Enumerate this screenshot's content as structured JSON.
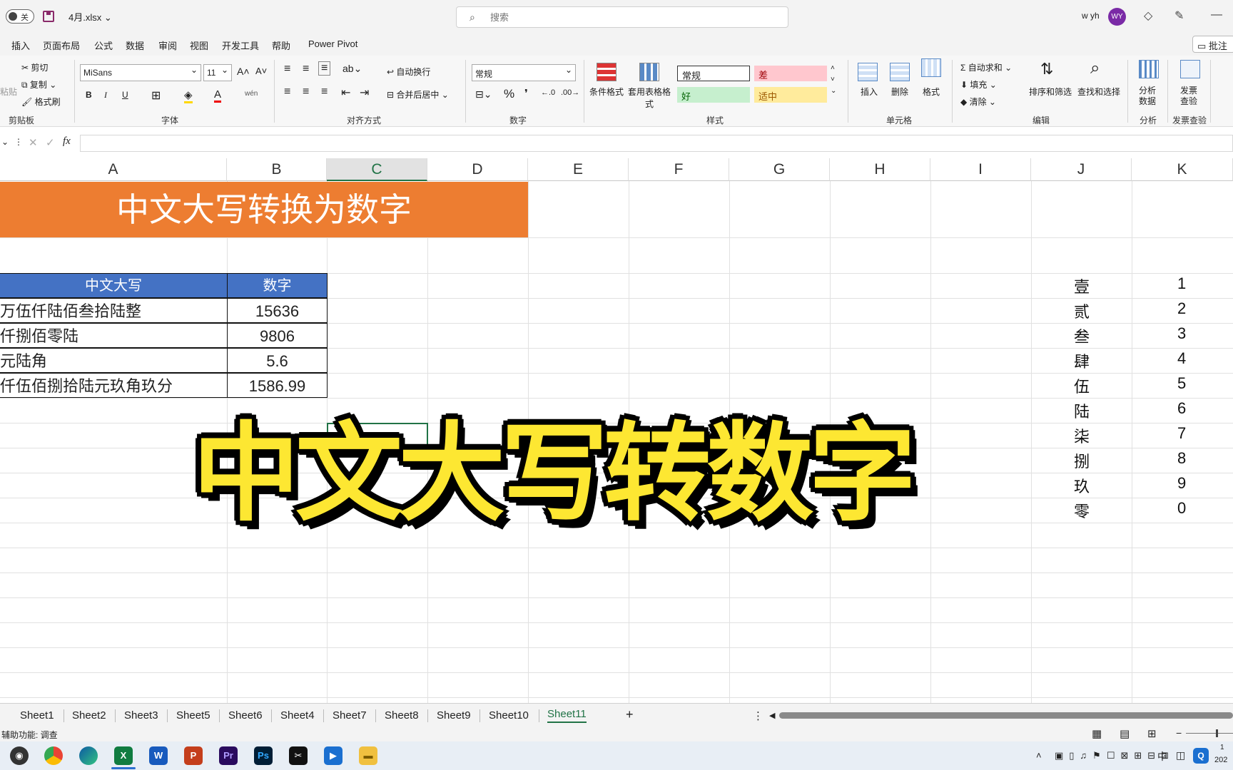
{
  "titlebar": {
    "autosave_label": "关",
    "filename": "4月.xlsx",
    "search_placeholder": "搜索",
    "username": "w yh",
    "avatar_initials": "WY"
  },
  "menu_tabs": [
    "插入",
    "页面布局",
    "公式",
    "数据",
    "审阅",
    "视图",
    "开发工具",
    "帮助",
    "Power Pivot"
  ],
  "comment_button": "批注",
  "ribbon": {
    "clipboard": {
      "paste": "粘贴",
      "cut": "剪切",
      "copy": "复制",
      "format_painter": "格式刷",
      "label": "剪贴板"
    },
    "font": {
      "name": "MiSans",
      "size": "11",
      "bold": "B",
      "italic": "I",
      "underline": "U",
      "label": "字体"
    },
    "alignment": {
      "wrap": "自动换行",
      "merge": "合并后居中",
      "label": "对齐方式"
    },
    "number": {
      "format": "常规",
      "percent": "%",
      "label": "数字"
    },
    "styles": {
      "cond_format": "条件格式",
      "table_format": "套用表格格式",
      "normal": "常规",
      "bad": "差",
      "good": "好",
      "neutral": "适中",
      "label": "样式"
    },
    "cells": {
      "insert": "插入",
      "delete": "删除",
      "format": "格式",
      "label": "单元格"
    },
    "editing": {
      "autosum": "自动求和",
      "fill": "填充",
      "clear": "清除",
      "sort_filter": "排序和筛选",
      "find_select": "查找和选择",
      "label": "编辑"
    },
    "analysis": {
      "analyze": "分析数据",
      "label": "分析"
    },
    "invoice": {
      "check": "发票查验",
      "label": "发票查验"
    }
  },
  "formula_bar": {
    "fx": "fx",
    "value": ""
  },
  "columns": [
    "A",
    "B",
    "C",
    "D",
    "E",
    "F",
    "G",
    "H",
    "I",
    "J",
    "K"
  ],
  "banner_title": "中文大写转换为数字",
  "table": {
    "headers": [
      "中文大写",
      "数字"
    ],
    "rows": [
      [
        "万伍仟陆佰叁拾陆整",
        "15636"
      ],
      [
        "仟捌佰零陆",
        "9806"
      ],
      [
        "元陆角",
        "5.6"
      ],
      [
        "仟伍佰捌拾陆元玖角玖分",
        "1586.99"
      ]
    ]
  },
  "lookup": [
    [
      "壹",
      "1"
    ],
    [
      "贰",
      "2"
    ],
    [
      "叁",
      "3"
    ],
    [
      "肆",
      "4"
    ],
    [
      "伍",
      "5"
    ],
    [
      "陆",
      "6"
    ],
    [
      "柒",
      "7"
    ],
    [
      "捌",
      "8"
    ],
    [
      "玖",
      "9"
    ],
    [
      "零",
      "0"
    ]
  ],
  "overlay_text": "中文大写转数字",
  "sheets": [
    "Sheet1",
    "Sheet2",
    "Sheet3",
    "Sheet5",
    "Sheet6",
    "Sheet4",
    "Sheet7",
    "Sheet8",
    "Sheet9",
    "Sheet10",
    "Sheet11"
  ],
  "active_sheet": "Sheet11",
  "status": {
    "accessibility": "辅助功能: 调查"
  },
  "taskbar_apps": [
    "DaVinci",
    "Chrome",
    "Edge",
    "Excel",
    "Word",
    "PowerPoint",
    "Premiere",
    "Photoshop",
    "CapCut",
    "Video",
    "Explorer"
  ],
  "clock": {
    "time": "1",
    "date": "202"
  }
}
